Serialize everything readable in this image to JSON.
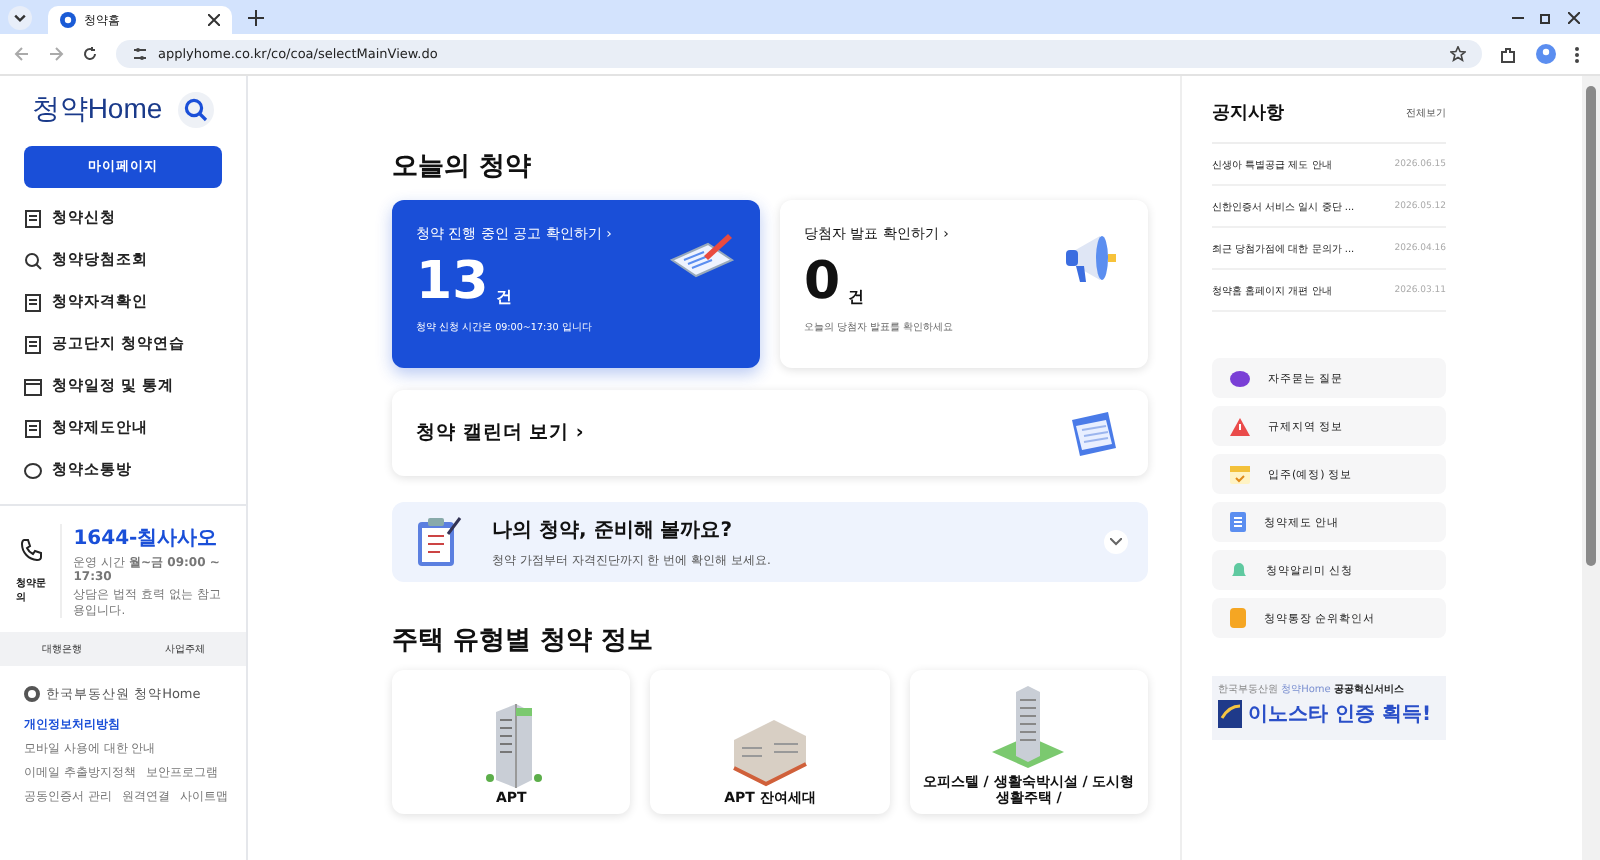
{
  "browser": {
    "tab_title": "청약홈",
    "url": "applyhome.co.kr/co/coa/selectMainView.do"
  },
  "sidebar": {
    "logo": "청약Home",
    "mypage_button": "마이페이지",
    "menu": [
      {
        "label": "청약신청",
        "kind": "doc"
      },
      {
        "label": "청약당첨조회",
        "kind": "search"
      },
      {
        "label": "청약자격확인",
        "kind": "badge"
      },
      {
        "label": "공고단지 청약연습",
        "kind": "practice"
      },
      {
        "label": "청약일정 및 통계",
        "kind": "calendar"
      },
      {
        "label": "청약제도안내",
        "kind": "guide"
      },
      {
        "label": "청약소통방",
        "kind": "chat"
      }
    ],
    "contact": {
      "label": "청약문의",
      "phone": "1644-칠사사오",
      "hours": "운영 시간 **월~금 09:00 ~ 17:30**",
      "note": "상담은 법적 효력 없는 참고용입니다."
    },
    "footer_tabs": [
      "대행은행",
      "사업주체"
    ],
    "footer_logo": "한국부동산원 청약Home",
    "footer_links": [
      {
        "text": "개인정보처리방침",
        "highlighted": true
      },
      {
        "text": "모바일 사용에 대한 안내",
        "highlighted": false
      },
      {
        "text": "이메일 추출방지정책",
        "highlighted": false
      },
      {
        "text": "보안프로그램",
        "highlighted": false
      },
      {
        "text": "공동인증서 관리",
        "highlighted": false
      },
      {
        "text": "원격연결",
        "highlighted": false
      },
      {
        "text": "사이트맵",
        "highlighted": false
      }
    ]
  },
  "main": {
    "today_title": "오늘의 청약",
    "cards": [
      {
        "kind": "primary",
        "link": "청약 진행 중인 공고 확인하기",
        "arrow": "›",
        "count": "13",
        "unit": "건",
        "note": "청약 신청 시간은 09:00~17:30 입니다"
      },
      {
        "kind": "secondary",
        "link": "당첨자 발표 확인하기",
        "arrow": "›",
        "count": "0",
        "unit": "건",
        "note": "오늘의 당첨자 발표를 확인하세요"
      }
    ],
    "calendar_link": "청약 캘린더 보기 ›",
    "prepare": {
      "title": "나의 청약, 준비해 볼까요?",
      "subtitle": "청약 가점부터 자격진단까지 한 번에 확인해 보세요.",
      "expanded": false
    },
    "housing_title": "주택 유형별 청약 정보",
    "housing": [
      {
        "kind": "tower",
        "label": "APT"
      },
      {
        "kind": "block",
        "label": "APT 잔여세대"
      },
      {
        "kind": "slim",
        "label": "오피스텔 / 생활숙박시설 / 도시형생활주택 /"
      }
    ]
  },
  "notices": {
    "title": "공지사항",
    "view_all": "전체보기",
    "items": [
      {
        "title": "신생아 특별공급 제도 안내",
        "date": "2026.06.15"
      },
      {
        "title": "신한인증서 서비스 일시 중단 ...",
        "date": "2026.05.12"
      },
      {
        "title": "최근 당첨가점에 대한 문의가 ...",
        "date": "2026.04.16"
      },
      {
        "title": "청약홈 홈페이지 개편 안내",
        "date": "2026.03.11"
      }
    ]
  },
  "quick_links": [
    {
      "kind": "faq",
      "label": "자주묻는 질문"
    },
    {
      "kind": "warning",
      "label": "규제지역 정보"
    },
    {
      "kind": "movein",
      "label": "입주(예정) 정보"
    },
    {
      "kind": "guide",
      "label": "청약제도 안내"
    },
    {
      "kind": "alarm",
      "label": "청약알리미 신청"
    },
    {
      "kind": "passbook",
      "label": "청약통장 순위확인서"
    }
  ],
  "banner": {
    "org": "한국부동산원",
    "brand": "청약Home",
    "service": "공공혁신서비스",
    "headline": "이노스타 인증 획득!"
  }
}
